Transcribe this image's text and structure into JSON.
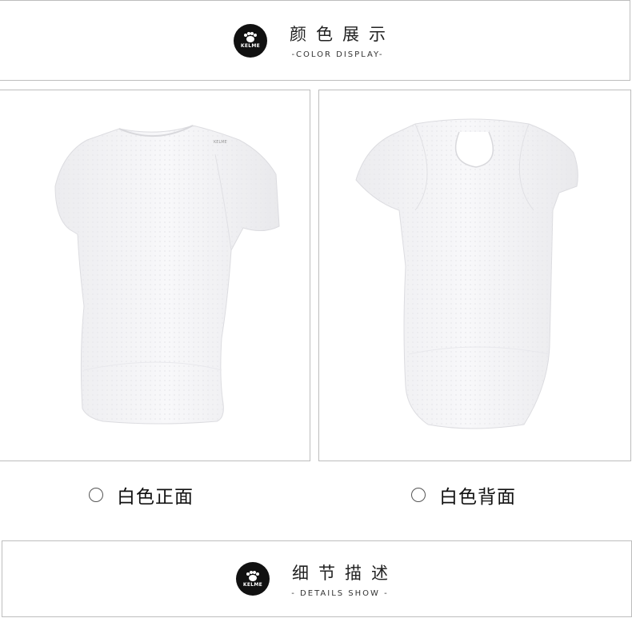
{
  "color_section": {
    "logo_text": "KELME",
    "title_zh": "颜色展示",
    "title_en": "-COLOR DISPLAY-"
  },
  "options": [
    {
      "label": "白色正面",
      "selected": false
    },
    {
      "label": "白色背面",
      "selected": false
    }
  ],
  "details_section": {
    "logo_text": "KELME",
    "title_zh": "细节描述",
    "title_en": "- DETAILS SHOW -"
  },
  "colors": {
    "border": "#bdbdbd",
    "logo_bg": "#111111",
    "shirt": "#f4f4f6"
  }
}
